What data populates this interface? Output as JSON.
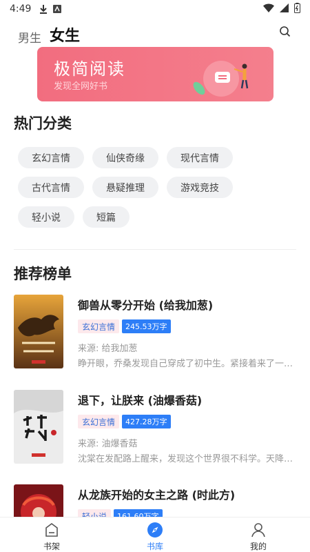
{
  "status_bar": {
    "time": "4:49"
  },
  "top_tabs": [
    {
      "label": "男生",
      "active": false
    },
    {
      "label": "女生",
      "active": true
    }
  ],
  "banner": {
    "title": "极简阅读",
    "subtitle": "发现全网好书"
  },
  "hot_categories": {
    "title": "热门分类",
    "items": [
      "玄幻言情",
      "仙侠奇缘",
      "现代言情",
      "古代言情",
      "悬疑推理",
      "游戏竞技",
      "轻小说",
      "短篇"
    ]
  },
  "rankings": {
    "title": "推荐榜单",
    "books": [
      {
        "title": "御兽从零分开始 (给我加葱)",
        "category": "玄幻言情",
        "words": "245.53万字",
        "source": "来源: 给我加葱",
        "desc": "睁开眼，乔桑发现自己穿成了初中生。紧接着来了一…",
        "cover_color": "#c98a2c"
      },
      {
        "title": "退下，让朕来 (油爆香菇)",
        "category": "玄幻言情",
        "words": "427.28万字",
        "source": "来源: 油爆香菇",
        "desc": "沈棠在发配路上醒来，发现这个世界很不科学。天降…",
        "cover_color": "#e9e9e9"
      },
      {
        "title": "从龙族开始的女主之路 (时此方)",
        "category": "轻小说",
        "words": "161.60万字",
        "source": "",
        "desc": "",
        "cover_color": "#b8242a"
      }
    ]
  },
  "bottom_nav": [
    {
      "label": "书架",
      "icon": "bookshelf-icon",
      "active": false
    },
    {
      "label": "书库",
      "icon": "compass-icon",
      "active": true
    },
    {
      "label": "我的",
      "icon": "profile-icon",
      "active": false
    }
  ],
  "colors": {
    "accent": "#2d7ef7",
    "banner": "#f26d7f",
    "chip_bg": "#f0f1f3"
  }
}
